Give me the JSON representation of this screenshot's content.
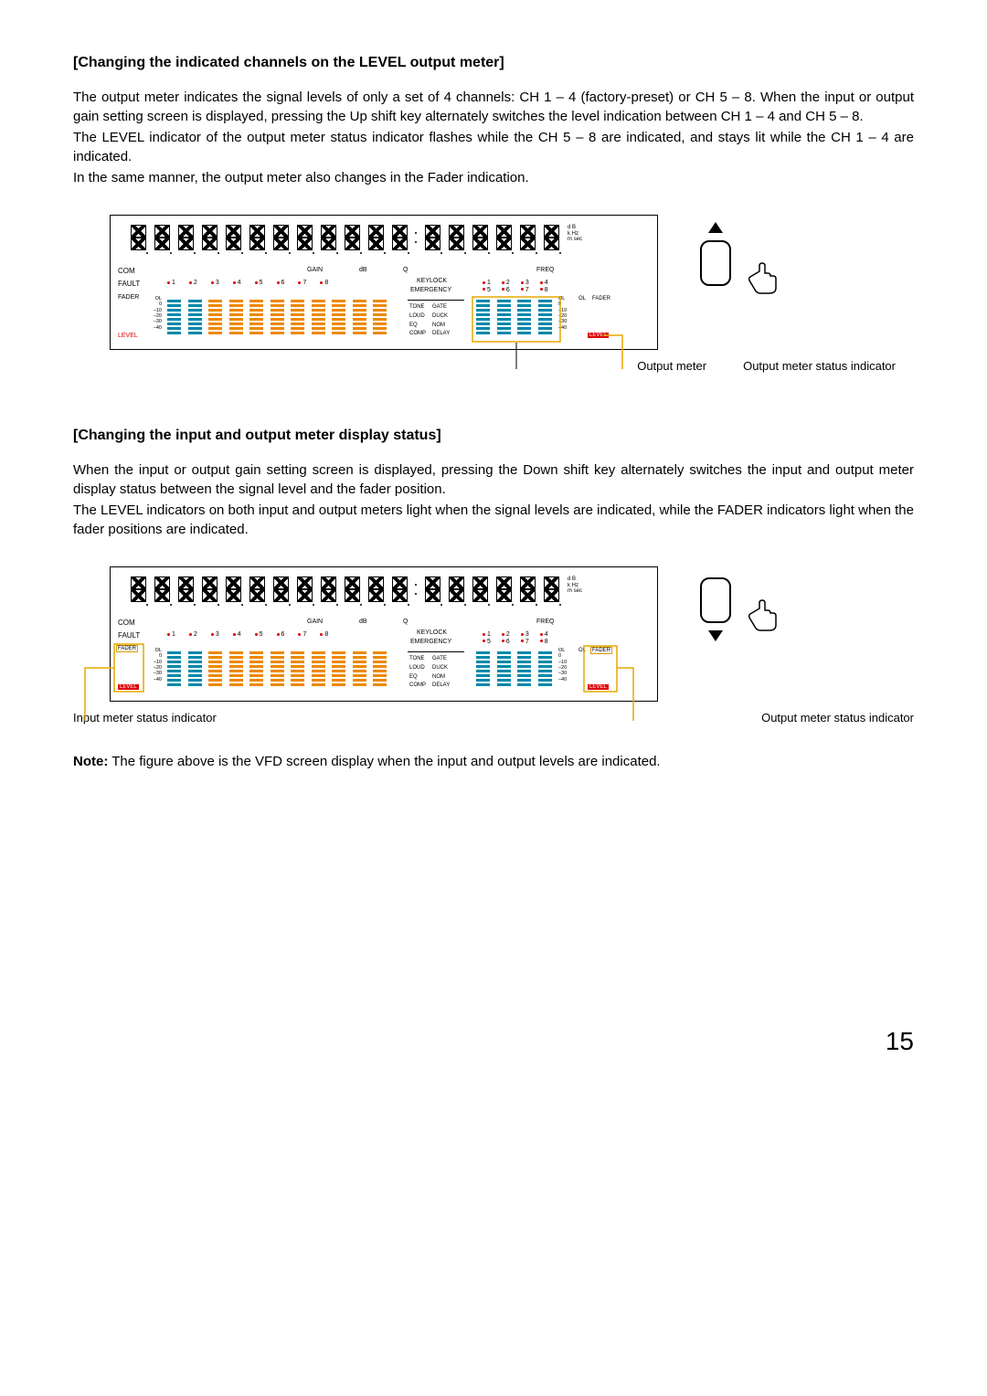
{
  "section1": {
    "heading": "[Changing the indicated channels on the LEVEL output meter]",
    "p1": "The output meter indicates the signal levels of only a set of 4 channels: CH 1 – 4 (factory-preset) or CH 5 – 8. When the input or output gain setting screen is displayed, pressing the Up shift key alternately switches the level indication between CH 1 – 4 and CH 5 – 8.",
    "p2": "The LEVEL indicator of the output meter status indicator flashes while the CH 5 – 8 are indicated, and stays lit while the CH 1 – 4 are indicated.",
    "p3": "In the same manner, the output meter also changes in the Fader indication."
  },
  "section2": {
    "heading": "[Changing the input and output meter display status]",
    "p1": "When the input or output gain setting screen is displayed, pressing the Down shift key alternately switches the input and output meter display status between the signal level and the fader position.",
    "p2": "The LEVEL indicators on both input and output meters light when the signal levels are indicated, while the FADER indicators light when the fader positions are indicated."
  },
  "panel": {
    "com": "COM",
    "fault": "FAULT",
    "fader": "FADER",
    "level": "LEVEL",
    "gain": "GAIN",
    "db": "dB",
    "q": "Q",
    "freq": "FREQ",
    "keylock": "KEYLOCK",
    "emergency": "EMERGENCY",
    "ol": "OL",
    "channels": [
      "1",
      "2",
      "3",
      "4",
      "5",
      "6",
      "7",
      "8"
    ],
    "output_pairs_top": [
      "1",
      "2",
      "3",
      "4"
    ],
    "output_pairs_bot": [
      "5",
      "6",
      "7",
      "8"
    ],
    "scale": [
      "OL",
      "0",
      "–10",
      "–20",
      "–30",
      "–40"
    ],
    "units_col": [
      "d B",
      "k   Hz",
      "m sec"
    ],
    "mid": {
      "r1": [
        "TONE",
        "GATE"
      ],
      "r2": [
        "LOUD",
        "DUCK"
      ],
      "r3": [
        "EQ",
        "NOM"
      ],
      "r4": [
        "COMP",
        "DELAY"
      ]
    }
  },
  "callouts": {
    "output_meter": "Output meter",
    "output_status": "Output meter status indicator",
    "input_status": "Input meter status indicator"
  },
  "note": {
    "bold": "Note:",
    "text": " The figure above is the VFD screen display when the input and output levels are indicated."
  },
  "page": "15"
}
